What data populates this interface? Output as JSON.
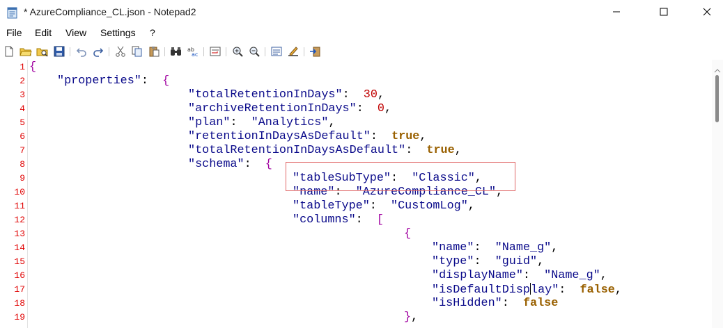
{
  "window": {
    "title": "* AzureCompliance_CL.json - Notepad2",
    "minimize_icon": "minimize-icon",
    "maximize_icon": "maximize-icon",
    "close_icon": "close-icon"
  },
  "menu": [
    "File",
    "Edit",
    "View",
    "Settings",
    "?"
  ],
  "toolbar": {
    "icons": [
      "new-file-icon",
      "open-icon",
      "browse-icon",
      "save-icon",
      "undo-icon",
      "redo-icon",
      "cut-icon",
      "copy-icon",
      "paste-icon",
      "find-icon",
      "replace-icon",
      "word-wrap-icon",
      "zoom-in-icon",
      "zoom-out-icon",
      "settings-icon",
      "scheme-icon",
      "exit-icon"
    ]
  },
  "editor": {
    "line_numbers": [
      "1",
      "2",
      "3",
      "4",
      "5",
      "6",
      "7",
      "8",
      "9",
      "10",
      "11",
      "12",
      "13",
      "14",
      "15",
      "16",
      "17",
      "18",
      "19"
    ],
    "lines": [
      [
        {
          "t": "{",
          "c": "brace"
        }
      ],
      [
        {
          "t": "\"properties\"",
          "c": "str"
        },
        {
          "t": ":  ",
          "c": "punct"
        },
        {
          "t": "{",
          "c": "brace"
        }
      ],
      [
        {
          "t": "\"totalRetentionInDays\"",
          "c": "str"
        },
        {
          "t": ":  ",
          "c": "punct"
        },
        {
          "t": "30",
          "c": "num"
        },
        {
          "t": ",",
          "c": "punct"
        }
      ],
      [
        {
          "t": "\"archiveRetentionInDays\"",
          "c": "str"
        },
        {
          "t": ":  ",
          "c": "punct"
        },
        {
          "t": "0",
          "c": "num"
        },
        {
          "t": ",",
          "c": "punct"
        }
      ],
      [
        {
          "t": "\"plan\"",
          "c": "str"
        },
        {
          "t": ":  ",
          "c": "punct"
        },
        {
          "t": "\"Analytics\"",
          "c": "str"
        },
        {
          "t": ",",
          "c": "punct"
        }
      ],
      [
        {
          "t": "\"retentionInDaysAsDefault\"",
          "c": "str"
        },
        {
          "t": ":  ",
          "c": "punct"
        },
        {
          "t": "true",
          "c": "kw"
        },
        {
          "t": ",",
          "c": "punct"
        }
      ],
      [
        {
          "t": "\"totalRetentionInDaysAsDefault\"",
          "c": "str"
        },
        {
          "t": ":  ",
          "c": "punct"
        },
        {
          "t": "true",
          "c": "kw"
        },
        {
          "t": ",",
          "c": "punct"
        }
      ],
      [
        {
          "t": "\"schema\"",
          "c": "str"
        },
        {
          "t": ":  ",
          "c": "punct"
        },
        {
          "t": "{",
          "c": "brace"
        }
      ],
      [
        {
          "t": "\"tableSubType\"",
          "c": "str"
        },
        {
          "t": ":  ",
          "c": "punct"
        },
        {
          "t": "\"Classic\"",
          "c": "str"
        },
        {
          "t": ",",
          "c": "punct"
        }
      ],
      [
        {
          "t": "\"name\"",
          "c": "str"
        },
        {
          "t": ":  ",
          "c": "punct"
        },
        {
          "t": "\"AzureCompliance_CL\"",
          "c": "str"
        },
        {
          "t": ",",
          "c": "punct"
        }
      ],
      [
        {
          "t": "\"tableType\"",
          "c": "str"
        },
        {
          "t": ":  ",
          "c": "punct"
        },
        {
          "t": "\"CustomLog\"",
          "c": "str"
        },
        {
          "t": ",",
          "c": "punct"
        }
      ],
      [
        {
          "t": "\"columns\"",
          "c": "str"
        },
        {
          "t": ":  ",
          "c": "punct"
        },
        {
          "t": "[",
          "c": "brace"
        }
      ],
      [
        {
          "t": "{",
          "c": "brace"
        }
      ],
      [
        {
          "t": "\"name\"",
          "c": "str"
        },
        {
          "t": ":  ",
          "c": "punct"
        },
        {
          "t": "\"Name_g\"",
          "c": "str"
        },
        {
          "t": ",",
          "c": "punct"
        }
      ],
      [
        {
          "t": "\"type\"",
          "c": "str"
        },
        {
          "t": ":  ",
          "c": "punct"
        },
        {
          "t": "\"guid\"",
          "c": "str"
        },
        {
          "t": ",",
          "c": "punct"
        }
      ],
      [
        {
          "t": "\"displayName\"",
          "c": "str"
        },
        {
          "t": ":  ",
          "c": "punct"
        },
        {
          "t": "\"Name_g\"",
          "c": "str"
        },
        {
          "t": ",",
          "c": "punct"
        }
      ],
      [
        {
          "t": "\"isDefaultDisp",
          "c": "str"
        },
        {
          "t": "|",
          "c": "caret"
        },
        {
          "t": "lay\"",
          "c": "str"
        },
        {
          "t": ":  ",
          "c": "punct"
        },
        {
          "t": "false",
          "c": "kw"
        },
        {
          "t": ",",
          "c": "punct"
        }
      ],
      [
        {
          "t": "\"isHidden\"",
          "c": "str"
        },
        {
          "t": ":  ",
          "c": "punct"
        },
        {
          "t": "false",
          "c": "kw"
        }
      ],
      [
        {
          "t": "}",
          "c": "brace"
        },
        {
          "t": ",",
          "c": "punct"
        }
      ]
    ]
  }
}
